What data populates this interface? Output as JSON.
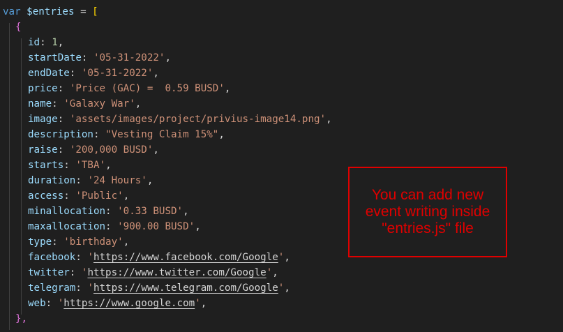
{
  "code": {
    "declaration": {
      "keyword": "var",
      "name": "$entries",
      "operator": "=",
      "open": "["
    },
    "entry": {
      "open": "{",
      "close": "},",
      "fields": [
        {
          "key": "id",
          "value": "1",
          "kind": "number"
        },
        {
          "key": "startDate",
          "value": "'05-31-2022'",
          "kind": "string"
        },
        {
          "key": "endDate",
          "value": "'05-31-2022'",
          "kind": "string"
        },
        {
          "key": "price",
          "value": "'Price (GAC) =  0.59 BUSD'",
          "kind": "string"
        },
        {
          "key": "name",
          "value": "'Galaxy War'",
          "kind": "string"
        },
        {
          "key": "image",
          "value": "'assets/images/project/privius-image14.png'",
          "kind": "string"
        },
        {
          "key": "description",
          "value": "\"Vesting Claim 15%\"",
          "kind": "string"
        },
        {
          "key": "raise",
          "value": "'200,000 BUSD'",
          "kind": "string"
        },
        {
          "key": "starts",
          "value": "'TBA'",
          "kind": "string"
        },
        {
          "key": "duration",
          "value": "'24 Hours'",
          "kind": "string"
        },
        {
          "key": "access",
          "value": "'Public'",
          "kind": "string"
        },
        {
          "key": "minallocation",
          "value": "'0.33 BUSD'",
          "kind": "string"
        },
        {
          "key": "maxallocation",
          "value": "'900.00 BUSD'",
          "kind": "string"
        },
        {
          "key": "type",
          "value": "'birthday'",
          "kind": "string"
        },
        {
          "key": "facebook",
          "value": "https://www.facebook.com/Google",
          "kind": "url"
        },
        {
          "key": "twitter",
          "value": "https://www.twitter.com/Google",
          "kind": "url"
        },
        {
          "key": "telegram",
          "value": "https://www.telegram.com/Google",
          "kind": "url"
        },
        {
          "key": "web",
          "value": "https://www.google.com",
          "kind": "url"
        }
      ]
    }
  },
  "annotation": {
    "text": "You can add new event writing inside \"entries.js\" file",
    "color": "#e00000"
  },
  "colors": {
    "background": "#1f1f1f",
    "keyword": "#569cd6",
    "property": "#9cdcfe",
    "string": "#ce9178",
    "number": "#b5cea8",
    "bracket_outer": "#ffd700",
    "bracket_inner": "#da70d6"
  }
}
